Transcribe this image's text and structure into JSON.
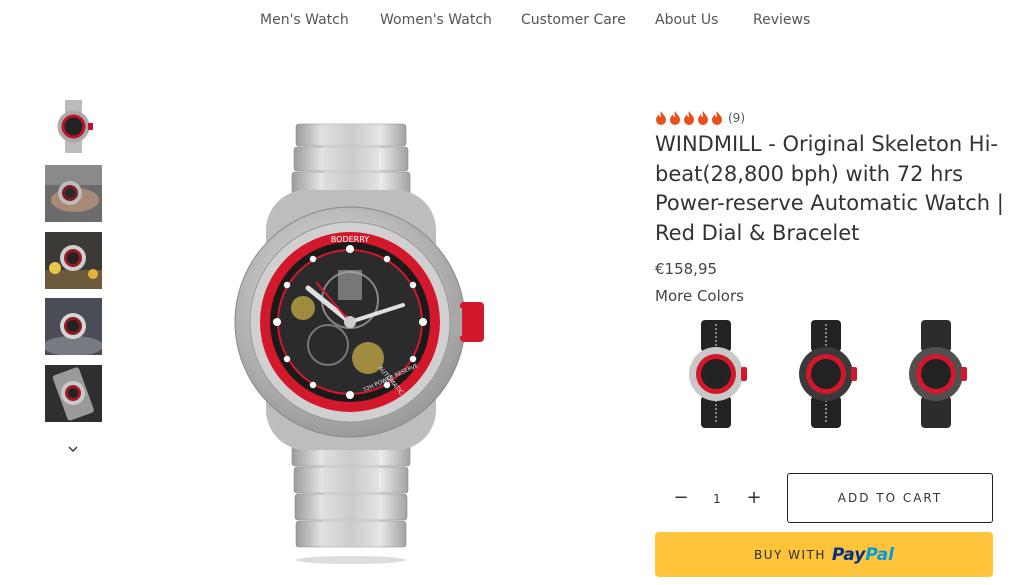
{
  "nav": {
    "items": [
      {
        "label": "Men's Watch"
      },
      {
        "label": "Women's Watch"
      },
      {
        "label": "Customer Care"
      },
      {
        "label": "About Us"
      },
      {
        "label": "Reviews"
      }
    ]
  },
  "product": {
    "rating_count": "(9)",
    "rating_value": 5,
    "title": "WINDMILL - Original Skeleton Hi-beat(28,800 bph) with 72 hrs Power-reserve Automatic Watch | Red Dial & Bracelet",
    "price": "€158,95",
    "more_colors_label": "More Colors",
    "quantity": "1",
    "qty_minus": "−",
    "qty_plus": "+",
    "add_to_cart": "ADD TO CART",
    "paypal_prefix": "BUY WITH",
    "paypal_logo_pay": "Pay",
    "paypal_logo_pal": "Pal"
  },
  "watch_dial": {
    "brand": "BODERRY",
    "text_automatic": "AUTOMATIC",
    "text_power": "72H POWER RESERVE"
  },
  "colors": {
    "accent_red": "#d3182b",
    "paypal_yellow": "#ffc439",
    "flame": "#e8501c"
  },
  "icons": {
    "rating": "flame-icon",
    "thumb_nav": "chevron-down-icon"
  }
}
